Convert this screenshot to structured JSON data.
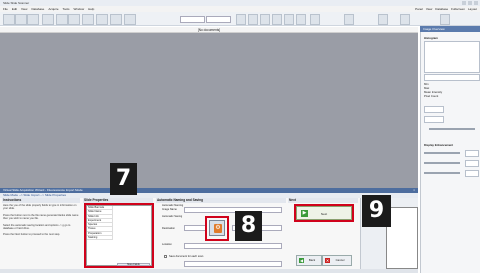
{
  "app": {
    "title": "Slide Slide Scanner",
    "menu": [
      "File",
      "Edit",
      "View",
      "Database",
      "Acquire",
      "Tools",
      "Window",
      "Help"
    ],
    "toolbar_right_tabs": [
      "Panel",
      "View",
      "Database",
      "Fullscreen",
      "Layout"
    ]
  },
  "document_tab": "[No documents]",
  "right_panel": {
    "title": "Image Overview",
    "histogram_label": "Histogram",
    "display_enhancement_label": "Display Enhancement",
    "fields": [
      "Min",
      "Max",
      "Mean Intensity",
      "Pixel Count"
    ]
  },
  "wizard": {
    "title": "Virtual Slide Acquisition Wizard - Fluorescence Import Mode",
    "breadcrumb": "Slide Mode  -->  Slide Import  -->  Slide Properties",
    "instructions_title": "Instructions",
    "instructions": [
      "Here the you of the slide properly fields to type in information on your slide.",
      "Press the button next to the file name generate blanks slide name then you wish to name you file.",
      "Select the automatic saving location and options -> g go to database or hard drive.",
      "Press the Next button to proceed to the next step."
    ],
    "slide_properties_title": "Slide Properties",
    "slide_properties_rows": [
      "Slide Barcode",
      "Slide Name",
      "Slide Info",
      "Experiment",
      "Species",
      "Tissue",
      "Preparation",
      "Staining"
    ],
    "slide_properties_button": "More Fields",
    "auto_title": "Automatic Naming and Saving",
    "auto_labels": [
      "Automatic Naming",
      "Image Name",
      "Automatic Saving",
      "Destination",
      "Location",
      "Save document for each scan"
    ],
    "next_title": "Next",
    "next_label": "Next",
    "back_label": "Back",
    "cancel_label": "Cancel"
  },
  "badges": {
    "seven": "7",
    "eight": "8",
    "nine": "9"
  },
  "colors": {
    "accent": "#d0021b",
    "header": "#4d6d9e"
  }
}
